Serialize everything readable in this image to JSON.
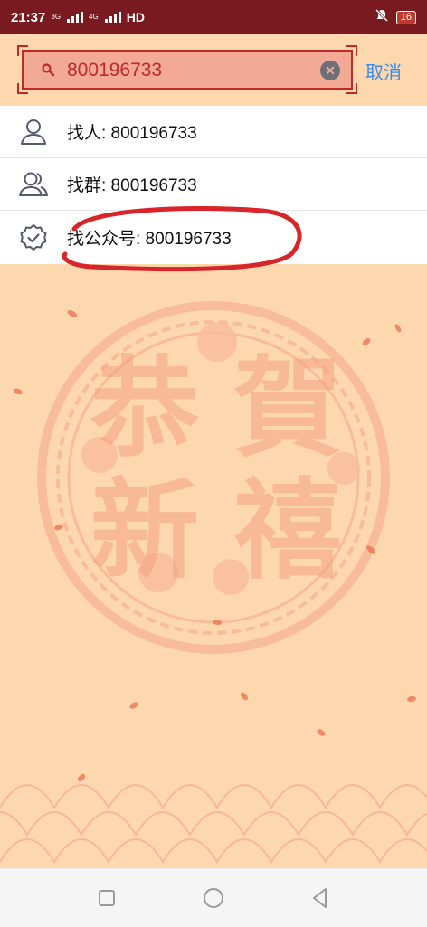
{
  "status_bar": {
    "time": "21:37",
    "net1": "3G",
    "net2": "4G",
    "hd": "HD",
    "battery": "16"
  },
  "search": {
    "value": "800196733",
    "cancel_label": "取消"
  },
  "results": [
    {
      "label": "找人: 800196733",
      "icon": "person-icon"
    },
    {
      "label": "找群: 800196733",
      "icon": "group-icon"
    },
    {
      "label": "找公众号: 800196733",
      "icon": "verified-badge-icon"
    }
  ],
  "background_text": [
    "恭",
    "賀",
    "新",
    "禧"
  ],
  "colors": {
    "status_bar_bg": "#781a1f",
    "page_bg": "#fdd7ae",
    "search_border": "#c0282a",
    "cancel": "#3b8ee8",
    "annotation": "#d8252a"
  }
}
